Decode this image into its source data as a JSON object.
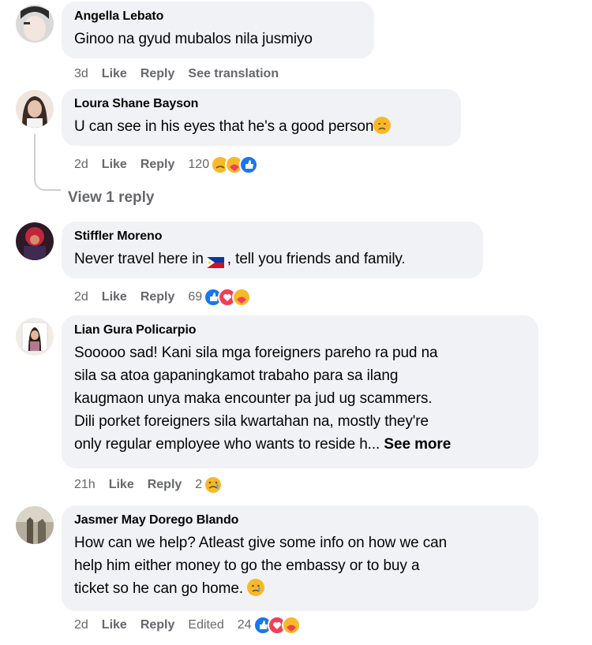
{
  "comments": [
    {
      "author": "Angella Lebato",
      "text": "Ginoo na gyud mubalos nila jusmiyo",
      "time": "3d",
      "like": "Like",
      "reply": "Reply",
      "extra": "See translation",
      "avatar_color": "#b8b8b8"
    },
    {
      "author": "Loura Shane Bayson",
      "text": "U can see in his eyes that he's a good person",
      "time": "2d",
      "like": "Like",
      "reply": "Reply",
      "reaction_count": "120",
      "view_replies": "View 1 reply",
      "avatar_color": "#c9a08d"
    },
    {
      "author": "Stiffler Moreno",
      "text_before": "Never travel here in",
      "text_after": ", tell you friends and family.",
      "time": "2d",
      "like": "Like",
      "reply": "Reply",
      "reaction_count": "69",
      "avatar_color": "#7a1c24"
    },
    {
      "author": "Lian Gura Policarpio",
      "text_lines": [
        "Sooooo sad! Kani sila mga foreigners pareho ra pud na",
        "sila sa atoa gapaningkamot trabaho para sa ilang",
        "kaugmaon unya maka encounter pa jud ug scammers.",
        "Dili porket foreigners sila kwartahan na, mostly they're",
        "only regular employee who wants to reside h..."
      ],
      "see_more": "See more",
      "time": "21h",
      "like": "Like",
      "reply": "Reply",
      "reaction_count": "2",
      "avatar_color": "#e8d8d0"
    },
    {
      "author": "Jasmer May Dorego Blando",
      "text_lines": [
        "How can we help? Atleast give some info on how we can",
        "help him either money to go the embassy or to buy a",
        "ticket so he can go home."
      ],
      "time": "2d",
      "like": "Like",
      "reply": "Reply",
      "extra": "Edited",
      "reaction_count": "24",
      "avatar_color": "#8f8a7a"
    }
  ]
}
